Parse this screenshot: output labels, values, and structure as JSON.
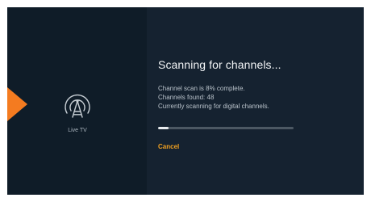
{
  "left_panel": {
    "selected_app_label": "Live TV",
    "icon": "antenna-tower-icon",
    "pointer_color": "#f47b20"
  },
  "scan": {
    "title": "Scanning for channels...",
    "status_line_1": "Channel scan is 8% complete.",
    "status_line_2": "Channels found: 48",
    "status_line_3": "Currently scanning for digital channels.",
    "progress_fraction": 0.08
  },
  "actions": {
    "cancel_label": "Cancel",
    "accent_color": "#f0a020"
  }
}
